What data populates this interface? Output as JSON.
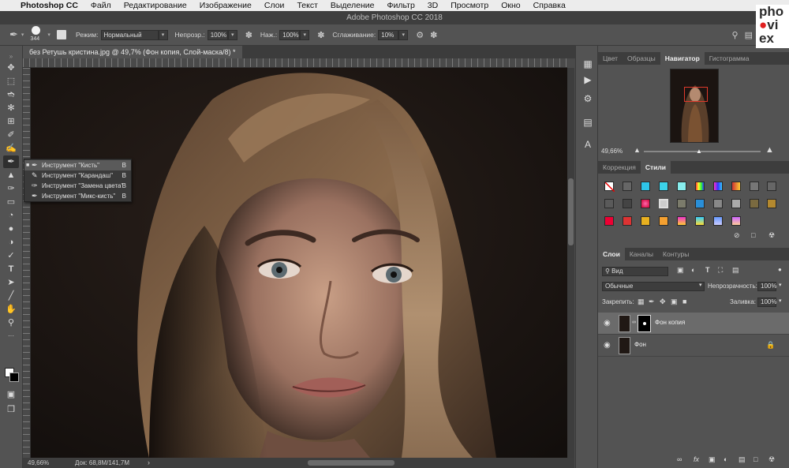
{
  "menubar": {
    "apple": "",
    "app": "Photoshop CC",
    "items": [
      "Файл",
      "Редактирование",
      "Изображение",
      "Слои",
      "Текст",
      "Выделение",
      "Фильтр",
      "3D",
      "Просмотр",
      "Окно",
      "Справка"
    ]
  },
  "window": {
    "title": "Adobe Photoshop CC 2018"
  },
  "options": {
    "brush_size": "344",
    "mode_label": "Режим:",
    "mode_value": "Нормальный",
    "opacity_label": "Непрозр.:",
    "opacity_value": "100%",
    "flow_label": "Наж.:",
    "flow_value": "100%",
    "smoothing_label": "Сглаживание:",
    "smoothing_value": "10%"
  },
  "document": {
    "tab_title": "без Ретушь кристина.jpg @ 49,7% (Фон копия, Слой-маска/8) *"
  },
  "status": {
    "zoom": "49,66%",
    "doc_info": "Док: 68,8M/141,7M"
  },
  "tool_flyout": {
    "items": [
      {
        "label": "Инструмент \"Кисть\"",
        "key": "B"
      },
      {
        "label": "Инструмент \"Карандаш\"",
        "key": "B"
      },
      {
        "label": "Инструмент \"Замена цвета\"",
        "key": "B"
      },
      {
        "label": "Инструмент \"Микс-кисть\"",
        "key": "B"
      }
    ]
  },
  "panels": {
    "top_tabs": [
      "Цвет",
      "Образцы",
      "Навигатор",
      "Гистограмма"
    ],
    "navigator_zoom": "49,66%",
    "style_tabs": [
      "Коррекция",
      "Стили"
    ],
    "layers_tabs": [
      "Слои",
      "Каналы",
      "Контуры"
    ],
    "layers_filter": "Вид",
    "blend_mode": "Обычные",
    "opacity_label": "Непрозрачность:",
    "opacity_value": "100%",
    "lock_label": "Закрепить:",
    "fill_label": "Заливка:",
    "fill_value": "100%",
    "layers": [
      {
        "name": "Фон копия"
      },
      {
        "name": "Фон"
      }
    ]
  },
  "watermark": {
    "line1": "pho",
    "line2": "vi",
    "line3": "ex"
  },
  "colors": {
    "ui_bg": "#535353",
    "dark_bar": "#3d3d3d",
    "navigator_rect": "#e0392b"
  }
}
